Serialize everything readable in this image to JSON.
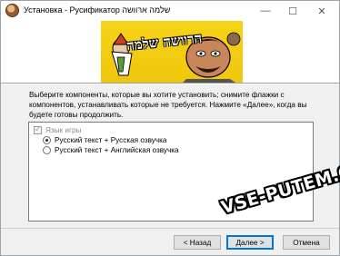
{
  "window": {
    "title": "Установка - Русификатор שלמה ארוושה",
    "minimize_glyph": "—",
    "maximize_glyph": "☐",
    "close_glyph": "✕"
  },
  "banner": {
    "caption": "הרוושה שלמה"
  },
  "description": "Выберите компоненты, которые вы хотите установить; снимите флажки с компонентов, устанавливать которые не требуется. Нажмите «Далее», когда вы будете готовы продолжить.",
  "components": {
    "group_label": "Язык игры",
    "group_checked": true,
    "options": [
      {
        "label": "Русский текст + Русская озвучка",
        "selected": true
      },
      {
        "label": "Русский текст + Английская озвучка",
        "selected": false
      }
    ]
  },
  "watermark": "VSE-PUTEM.COM",
  "buttons": {
    "back": "< Назад",
    "next": "Далее >",
    "cancel": "Отмена"
  }
}
